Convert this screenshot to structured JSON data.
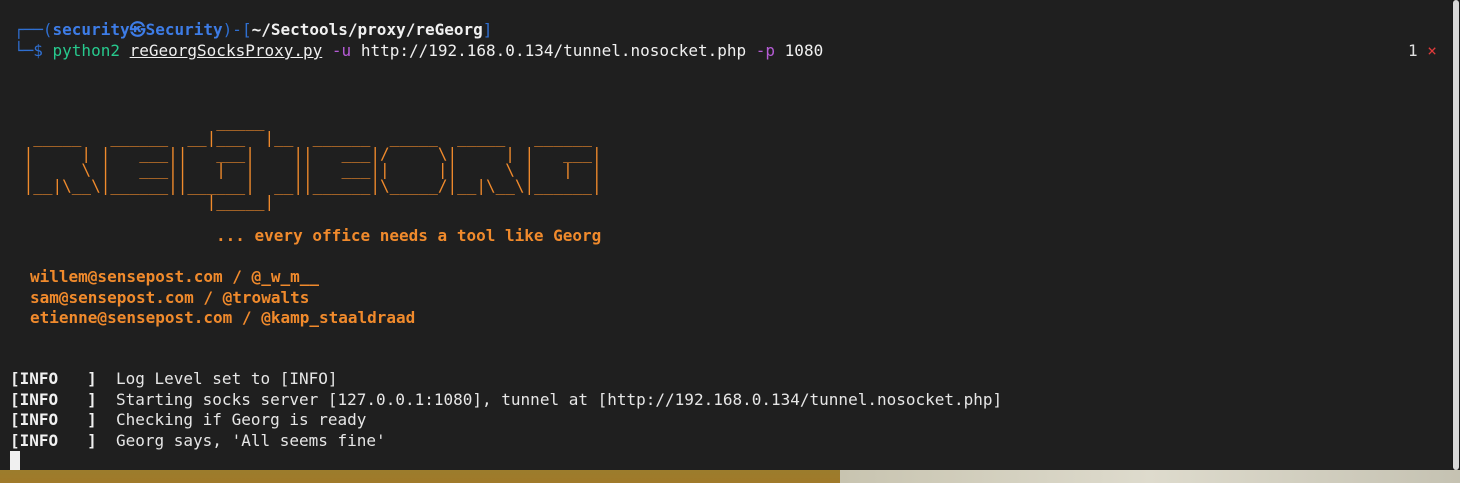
{
  "prompt": {
    "corner_top": "┌──(",
    "user": "security㉿Security",
    "sep": ")-[",
    "path": "~/Sectools/proxy/reGeorg",
    "close": "]",
    "corner_bottom": "└─",
    "dollar": "$ ",
    "command": "python2",
    "script": "reGeorgSocksProxy.py",
    "flag_u": "-u",
    "url": "http://192.168.0.134/tunnel.nosocket.php",
    "flag_p": "-p",
    "port": "1080"
  },
  "exit_status": {
    "code": "1",
    "mark": "×"
  },
  "banner": {
    "ascii": "                     _____\n  _____   ______  __|___  |__  ______  _____  _____   ______\n |     | |   ___||   ___|    ||   ___|/     \\|     | |   ___|\n |     \\ |   ___||   |  |    ||   ___||     ||     \\ |   |  |\n |__|\\__\\|______||______|  __||______|\\_____/|__|\\__\\|______|\n                    |_____|",
    "tagline": "... every office needs a tool like Georg"
  },
  "contacts": [
    "willem@sensepost.com / @_w_m__",
    "sam@sensepost.com / @trowalts",
    "etienne@sensepost.com / @kamp_staaldraad"
  ],
  "logs": [
    {
      "level": "[INFO   ]",
      "message": "  Log Level set to [INFO]"
    },
    {
      "level": "[INFO   ]",
      "message": "  Starting socks server [127.0.0.1:1080], tunnel at [http://192.168.0.134/tunnel.nosocket.php]"
    },
    {
      "level": "[INFO   ]",
      "message": "  Checking if Georg is ready"
    },
    {
      "level": "[INFO   ]",
      "message": "  Georg says, 'All seems fine'"
    }
  ]
}
